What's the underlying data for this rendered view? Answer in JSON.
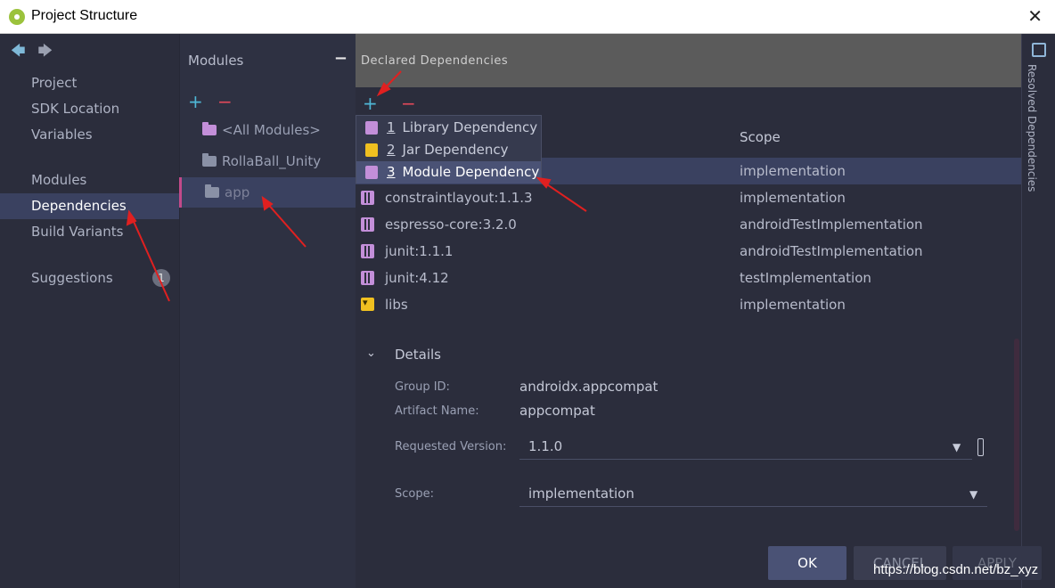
{
  "window": {
    "title": "Project Structure",
    "close_glyph": "✕"
  },
  "leftnav": {
    "back_glyph": "🡄",
    "forward_glyph": "🡆",
    "items": [
      {
        "label": "Project"
      },
      {
        "label": "SDK Location"
      },
      {
        "label": "Variables"
      },
      {
        "label": "Modules"
      },
      {
        "label": "Dependencies",
        "selected": true
      },
      {
        "label": "Build Variants"
      },
      {
        "label": "Suggestions"
      }
    ],
    "suggestions_badge": "1"
  },
  "modules": {
    "header": "Modules",
    "collapse_glyph": "−",
    "add_glyph": "+",
    "remove_glyph": "−",
    "items": [
      {
        "label": "<All Modules>"
      },
      {
        "label": "RollaBall_Unity"
      },
      {
        "label": "app",
        "selected": true
      }
    ]
  },
  "declared": {
    "header": "Declared Dependencies",
    "add_glyph": "+",
    "remove_glyph": "−",
    "scope_header": "Scope",
    "menu": [
      {
        "num": "1",
        "label": "Library Dependency",
        "icon": "library-icon"
      },
      {
        "num": "2",
        "label": "Jar Dependency",
        "icon": "jar-icon"
      },
      {
        "num": "3",
        "label": "Module Dependency",
        "icon": "module-icon",
        "selected": true
      }
    ],
    "rows": [
      {
        "name": "",
        "scope": "implementation",
        "icon": "library-icon",
        "selected": true
      },
      {
        "name": "constraintlayout:1.1.3",
        "scope": "implementation",
        "icon": "library-icon"
      },
      {
        "name": "espresso-core:3.2.0",
        "scope": "androidTestImplementation",
        "icon": "library-icon"
      },
      {
        "name": "junit:1.1.1",
        "scope": "androidTestImplementation",
        "icon": "library-icon"
      },
      {
        "name": "junit:4.12",
        "scope": "testImplementation",
        "icon": "library-icon"
      },
      {
        "name": "libs",
        "scope": "implementation",
        "icon": "jar-icon"
      }
    ]
  },
  "details": {
    "toggle_glyph": "⌄",
    "title": "Details",
    "group_id_label": "Group ID:",
    "group_id": "androidx.appcompat",
    "artifact_label": "Artifact Name:",
    "artifact": "appcompat",
    "version_label": "Requested Version:",
    "version": "1.1.0",
    "scope_label": "Scope:",
    "scope": "implementation",
    "dropdown_glyph": "▼"
  },
  "rightstrip": {
    "label": "Resolved Dependencies"
  },
  "buttons": {
    "ok": "OK",
    "cancel": "CANCEL",
    "apply": "APPLY"
  },
  "watermark": "https://blog.csdn.net/bz_xyz",
  "colors": {
    "accent": "#4fb7d6",
    "remove": "#e0485a",
    "annotation": "#e02020",
    "selection": "#3a4160"
  }
}
